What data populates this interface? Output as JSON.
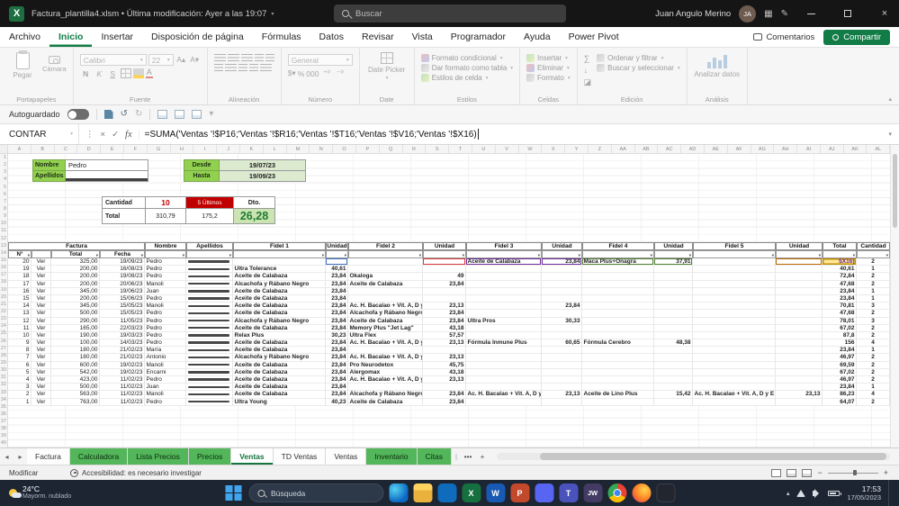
{
  "title_bar": {
    "title": "Factura_plantilla4.xlsm • Última modificación: Ayer a las 19:07",
    "search_placeholder": "Buscar",
    "user_name": "Juan Angulo Merino",
    "user_initials": "JA"
  },
  "ribbon": {
    "tabs": [
      "Archivo",
      "Inicio",
      "Insertar",
      "Disposición de página",
      "Fórmulas",
      "Datos",
      "Revisar",
      "Vista",
      "Programador",
      "Ayuda",
      "Power Pivot"
    ],
    "active_tab": "Inicio",
    "comments": "Comentarios",
    "share": "Compartir",
    "groups": {
      "clipboard": {
        "label": "Portapapeles",
        "paste": "Pegar",
        "camera": "Cámara"
      },
      "font": {
        "label": "Fuente",
        "font_name": "Calibri",
        "font_size": "22",
        "bold": "N",
        "italic": "K",
        "underline": "S"
      },
      "alignment": {
        "label": "Alineación"
      },
      "number": {
        "label": "Número",
        "format": "General",
        "percent": "%",
        "thousands": "000"
      },
      "date": {
        "label": "Date",
        "picker": "Date Picker"
      },
      "styles": {
        "label": "Estilos",
        "conditional": "Formato condicional",
        "format_table": "Dar formato como tabla",
        "cell_styles": "Estilos de celda"
      },
      "cells": {
        "label": "Celdas",
        "insert": "Insertar",
        "delete": "Eliminar",
        "format": "Formato"
      },
      "editing": {
        "label": "Edición",
        "sort": "Ordenar y filtrar",
        "find": "Buscar y seleccionar"
      },
      "analysis": {
        "label": "Análisis",
        "analyze": "Analizar datos"
      }
    }
  },
  "quick_bar": {
    "autosave_label": "Autoguardado"
  },
  "formula_bar": {
    "name_box": "CONTAR",
    "formula": "=SUMA('Ventas '!$P16;'Ventas '!$R16;'Ventas '!$T16;'Ventas '!$V16;'Ventas '!$X16)"
  },
  "grid": {
    "row_count": 40,
    "column_letter_count": 38
  },
  "summary": {
    "nombre_label": "Nombre",
    "nombre_value": "Pedro",
    "apellidos_label": "Apellidos",
    "apellidos_value": "",
    "desde_label": "Desde",
    "desde_value": "19/07/23",
    "hasta_label": "Hasta",
    "hasta_value": "19/09/23",
    "cantidad_label": "Cantidad",
    "cantidad_value": "10",
    "ultimos_label": "5 Últimos",
    "dto_label": "Dto.",
    "total_label": "Total",
    "total_value1": "310,79",
    "total_value2": "175,2",
    "dto_value": "26,28"
  },
  "table": {
    "headers": {
      "factura": "Factura",
      "nombre": "Nombre",
      "apellidos": "Apellidos",
      "fidel1": "Fidel 1",
      "fidel2": "Fidel 2",
      "fidel3": "Fidel 3",
      "fidel4": "Fidel 4",
      "fidel5": "Fidel 5",
      "unidad": "Unidad",
      "total": "Total",
      "cantidad": "Cantidad",
      "n": "N°",
      "total2": "Total",
      "fecha": "Fecha"
    },
    "rows": [
      {
        "editing": true,
        "n": "20",
        "ver": "Ver",
        "total": "325,00",
        "fecha": "19/09/23",
        "nombre": "Pedro",
        "f3": "Aceite de Calabaza",
        "u3": "23,84",
        "f4": "Maca Plus+Onagra",
        "u4": "37,91",
        "rtotal": "$X16)",
        "cant": "2"
      },
      {
        "n": "19",
        "ver": "Ver",
        "total": "200,00",
        "fecha": "16/08/23",
        "nombre": "Pedro",
        "f1": "Ultra Tolerance",
        "u1": "40,61",
        "rtotal": "40,61",
        "cant": "1"
      },
      {
        "n": "18",
        "ver": "Ver",
        "total": "200,00",
        "fecha": "19/08/23",
        "nombre": "Pedro",
        "f1": "Aceite de Calabaza",
        "u1": "23,84",
        "f2": "Okaloga",
        "u2": "49",
        "rtotal": "72,84",
        "cant": "2"
      },
      {
        "n": "17",
        "ver": "Ver",
        "total": "200,00",
        "fecha": "20/06/23",
        "nombre": "Manoli",
        "f1": "Alcachofa y Rábano Negro",
        "u1": "23,84",
        "f2": "Aceite de Calabaza",
        "u2": "23,84",
        "rtotal": "47,68",
        "cant": "2"
      },
      {
        "n": "16",
        "ver": "Ver",
        "total": "345,00",
        "fecha": "19/06/23",
        "nombre": "Juan",
        "f1": "Aceite de Calabaza",
        "u1": "23,84",
        "rtotal": "23,84",
        "cant": "1"
      },
      {
        "n": "15",
        "ver": "Ver",
        "total": "200,00",
        "fecha": "15/06/23",
        "nombre": "Pedro",
        "f1": "Aceite de Calabaza",
        "u1": "23,84",
        "rtotal": "23,84",
        "cant": "1"
      },
      {
        "n": "14",
        "ver": "Ver",
        "total": "345,00",
        "fecha": "15/05/23",
        "nombre": "Manoli",
        "f1": "Aceite de Calabaza",
        "u1": "23,84",
        "f2": "Ac. H. Bacalao + Vit. A, D y",
        "u2": "23,13",
        "u3": "23,84",
        "rtotal": "70,81",
        "cant": "3"
      },
      {
        "n": "13",
        "ver": "Ver",
        "total": "500,00",
        "fecha": "15/05/23",
        "nombre": "Pedro",
        "f1": "Aceite de Calabaza",
        "u1": "23,84",
        "f2": "Alcachofa y Rábano Negro",
        "u2": "23,84",
        "rtotal": "47,68",
        "cant": "2"
      },
      {
        "n": "12",
        "ver": "Ver",
        "total": "290,00",
        "fecha": "11/05/23",
        "nombre": "Pedro",
        "f1": "Alcachofa y Rábano Negro",
        "u1": "23,84",
        "f2": "Aceite de Calabaza",
        "u2": "23,84",
        "f3": "Ultra Pros",
        "u3": "30,33",
        "rtotal": "78,01",
        "cant": "3"
      },
      {
        "n": "11",
        "ver": "Ver",
        "total": "165,00",
        "fecha": "22/03/23",
        "nombre": "Pedro",
        "f1": "Aceite de Calabaza",
        "u1": "23,84",
        "f2": "Memory Plus \"Jet Lag\"",
        "u2": "43,18",
        "rtotal": "67,02",
        "cant": "2"
      },
      {
        "n": "10",
        "ver": "Ver",
        "total": "190,00",
        "fecha": "19/03/23",
        "nombre": "Pedro",
        "f1": "Relax Plus",
        "u1": "30,23",
        "f2": "Ultra Flex",
        "u2": "57,57",
        "rtotal": "87,8",
        "cant": "2"
      },
      {
        "n": "9",
        "ver": "Ver",
        "total": "100,00",
        "fecha": "14/03/23",
        "nombre": "Pedro",
        "f1": "Aceite de Calabaza",
        "u1": "23,84",
        "f2": "Ac. H. Bacalao + Vit. A, D y",
        "u2": "23,13",
        "f3": "Fórmula Inmune Plus",
        "u3": "60,65",
        "f4": "Fórmula Cerebro",
        "u4": "48,38",
        "rtotal": "156",
        "cant": "4"
      },
      {
        "n": "8",
        "ver": "Ver",
        "total": "180,00",
        "fecha": "21/02/23",
        "nombre": "María",
        "f1": "Aceite de Calabaza",
        "u1": "23,84",
        "rtotal": "23,84",
        "cant": "1"
      },
      {
        "n": "7",
        "ver": "Ver",
        "total": "180,00",
        "fecha": "21/02/23",
        "nombre": "Antonio",
        "f1": "Alcachofa y Rábano Negro",
        "u1": "23,84",
        "f2": "Ac. H. Bacalao + Vit. A, D y",
        "u2": "23,13",
        "rtotal": "46,97",
        "cant": "2"
      },
      {
        "n": "6",
        "ver": "Ver",
        "total": "600,00",
        "fecha": "19/02/23",
        "nombre": "Manoli",
        "f1": "Aceite de Calabaza",
        "u1": "23,84",
        "f2": "Pro Neurodetox",
        "u2": "45,75",
        "rtotal": "69,59",
        "cant": "2"
      },
      {
        "n": "5",
        "ver": "Ver",
        "total": "542,00",
        "fecha": "19/02/23",
        "nombre": "Encarni",
        "f1": "Aceite de Calabaza",
        "u1": "23,84",
        "f2": "Alergomax",
        "u2": "43,18",
        "rtotal": "67,02",
        "cant": "2"
      },
      {
        "n": "4",
        "ver": "Ver",
        "total": "423,00",
        "fecha": "11/02/23",
        "nombre": "Pedro",
        "f1": "Aceite de Calabaza",
        "u1": "23,84",
        "f2": "Ac. H. Bacalao + Vit. A, D y",
        "u2": "23,13",
        "rtotal": "46,97",
        "cant": "2"
      },
      {
        "n": "3",
        "ver": "Ver",
        "total": "500,00",
        "fecha": "11/02/23",
        "nombre": "Juan",
        "f1": "Aceite de Calabaza",
        "u1": "23,84",
        "rtotal": "23,84",
        "cant": "1"
      },
      {
        "n": "2",
        "ver": "Ver",
        "total": "563,00",
        "fecha": "11/02/23",
        "nombre": "Manoli",
        "f1": "Aceite de Calabaza",
        "u1": "23,84",
        "f2": "Alcachofa y Rábano Negro",
        "u2": "23,84",
        "f3": "Ac. H. Bacalao + Vit. A, D y",
        "u3": "23,13",
        "f4": "Aceite de Lino Plus",
        "u4": "15,42",
        "f5": "Ac. H. Bacalao + Vit. A, D y E",
        "u5": "23,13",
        "rtotal": "86,23",
        "cant": "4"
      },
      {
        "n": "1",
        "ver": "Ver",
        "total": "763,00",
        "fecha": "11/02/23",
        "nombre": "Pedro",
        "f1": "Ultra Young",
        "u1": "40,23",
        "f2": "Aceite de Calabaza",
        "u2": "23,84",
        "rtotal": "64,07",
        "cant": "2"
      }
    ]
  },
  "sheet_tabs": {
    "tabs": [
      {
        "label": "Factura",
        "style": "plain"
      },
      {
        "label": "Calculadora",
        "style": "green"
      },
      {
        "label": "Lista Precios",
        "style": "green"
      },
      {
        "label": "Precios",
        "style": "green"
      },
      {
        "label": "Ventas",
        "style": "active"
      },
      {
        "label": "TD Ventas",
        "style": "plain"
      },
      {
        "label": "Ventas",
        "style": "plain"
      },
      {
        "label": "Inventario",
        "style": "green"
      },
      {
        "label": "Citas",
        "style": "green"
      }
    ],
    "separator": "|",
    "more": "•••",
    "add": "+"
  },
  "status_bar": {
    "mode": "Modificar",
    "accessibility": "Accesibilidad: es necesario investigar"
  },
  "taskbar": {
    "weather_temp": "24°C",
    "weather_desc": "Mayorm. nublado",
    "search": "Búsqueda",
    "time": "17:53",
    "date": "17/05/2023",
    "icons": [
      {
        "name": "edge-icon",
        "cls": "ic-edge"
      },
      {
        "name": "file-explorer-icon",
        "cls": "ic-folder"
      },
      {
        "name": "store-icon",
        "cls": "ic-store"
      },
      {
        "name": "excel-icon",
        "cls": "ic-excel",
        "glyph": "X"
      },
      {
        "name": "word-icon",
        "cls": "ic-word",
        "glyph": "W"
      },
      {
        "name": "powerpoint-icon",
        "cls": "ic-ppt",
        "glyph": "P"
      },
      {
        "name": "discord-icon",
        "cls": "ic-discord"
      },
      {
        "name": "teams-icon",
        "cls": "ic-teams",
        "glyph": "T"
      },
      {
        "name": "jw-library-icon",
        "cls": "ic-jw",
        "glyph": "JW"
      },
      {
        "name": "chrome-icon",
        "cls": "ic-chrome"
      },
      {
        "name": "firefox-icon",
        "cls": "ic-firefox"
      },
      {
        "name": "terminal-icon",
        "cls": "ic-term"
      }
    ]
  }
}
